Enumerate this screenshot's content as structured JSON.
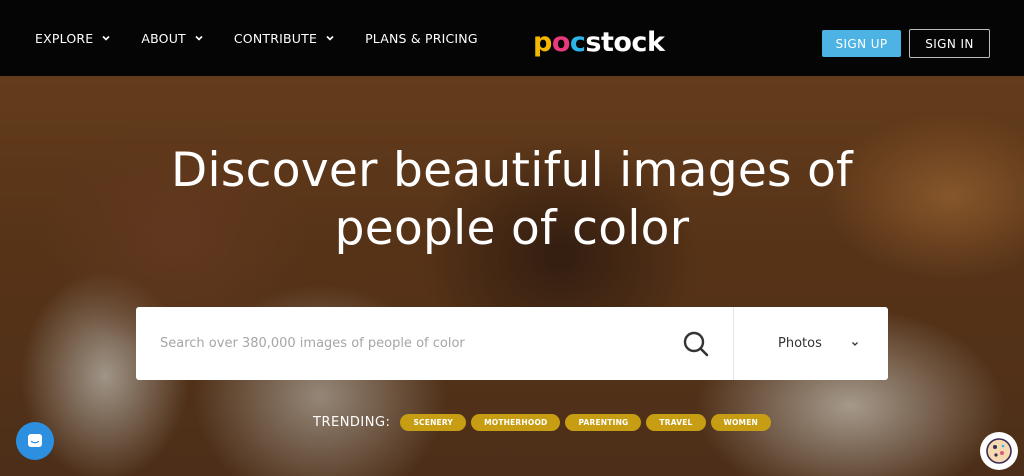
{
  "nav": {
    "items": [
      {
        "label": "EXPLORE",
        "has_dropdown": true
      },
      {
        "label": "ABOUT",
        "has_dropdown": true
      },
      {
        "label": "CONTRIBUTE",
        "has_dropdown": true
      },
      {
        "label": "PLANS & PRICING",
        "has_dropdown": false
      }
    ]
  },
  "logo": {
    "p": "p",
    "o": "o",
    "c": "c",
    "rest": "stock"
  },
  "auth": {
    "signup": "SIGN UP",
    "signin": "SIGN IN"
  },
  "hero": {
    "title_line1": "Discover beautiful images of",
    "title_line2": "people of color"
  },
  "search": {
    "placeholder": "Search over 380,000 images of people of color",
    "value": "",
    "type_selected": "Photos"
  },
  "trending": {
    "label": "TRENDING:",
    "tags": [
      "SCENERY",
      "MOTHERHOOD",
      "PARENTING",
      "TRAVEL",
      "WOMEN"
    ]
  },
  "icons": {
    "search": "search-icon",
    "chevron": "chevron-down-icon",
    "chat": "chat-icon",
    "cookie": "cookie-icon"
  },
  "colors": {
    "header_bg": "#050505",
    "signup_bg": "#4cb3e4",
    "tag_bg": "#c79d13",
    "chat_bg": "#2d8fe0",
    "logo_p": "#f5b800",
    "logo_o": "#e83a7b",
    "logo_c": "#2fb3e6"
  }
}
